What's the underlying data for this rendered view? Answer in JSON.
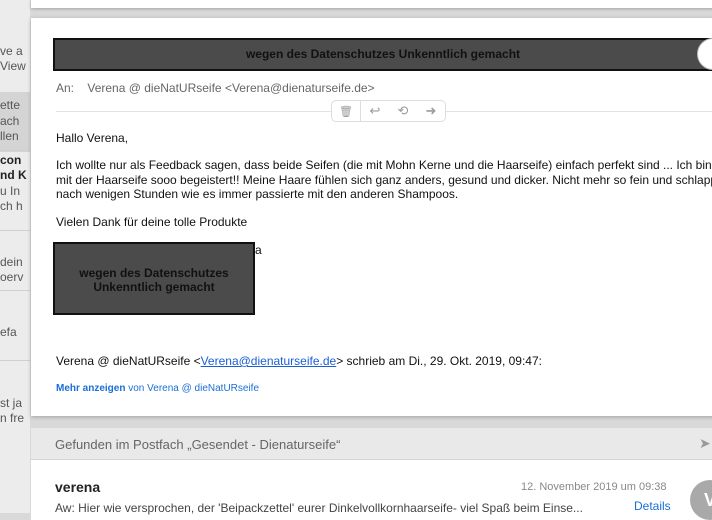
{
  "sidebar_fragments": [
    "ve a",
    "View",
    "ette",
    "ach",
    "llen",
    "con",
    "nd K",
    "u In",
    "ch h",
    "dein",
    "oerv",
    "efa",
    "st ja",
    "n fre"
  ],
  "header": {
    "redaction_text": "wegen des Datenschutzes Unkenntlich gemacht",
    "to_label": "An:",
    "to_value": "Verena @ dieNatURseife <Verena@dienaturseife.de>"
  },
  "toolbar": {
    "trash": "🗑",
    "reply": "↩",
    "reply_all": "⟲",
    "forward": "➜"
  },
  "body": {
    "greeting": "Hallo Verena,",
    "line1": "Ich wollte nur als Feedback sagen, dass beide Seifen (die mit Mohn Kerne und die Haarseife) einfach perfekt sind ... Ich bin",
    "line2": "mit der Haarseife sooo begeistert!! Meine Haare fühlen sich ganz anders, gesund und dicker. Nicht mehr so fein und schlapp",
    "line3": "nach wenigen Stunden wie es immer passierte mit den anderen Shampoos.",
    "thanks": "Vielen Dank für deine tolle Produkte",
    "sig_redaction": "wegen des Datenschutzes Unkenntlich gemacht",
    "sig_tail": "a"
  },
  "quote": {
    "prefix": "Verena @ dieNatURseife <",
    "email": "Verena@dienaturseife.de",
    "suffix": "> schrieb am Di., 29. Okt. 2019, 09:47:",
    "more_label": "Mehr anzeigen",
    "more_from": " von Verena @ dieNatURseife"
  },
  "found": {
    "text": "Gefunden im Postfach „Gesendet - Dienaturseife“"
  },
  "list_item": {
    "sender": "verena",
    "date": "12. November 2019 um 09:38",
    "subject": "Aw: Hier wie versprochen, der 'Beipackzettel' eurer Dinkelvollkornhaarseife- viel Spaß beim Einse...",
    "details": "Details",
    "avatar_initial": "V"
  }
}
